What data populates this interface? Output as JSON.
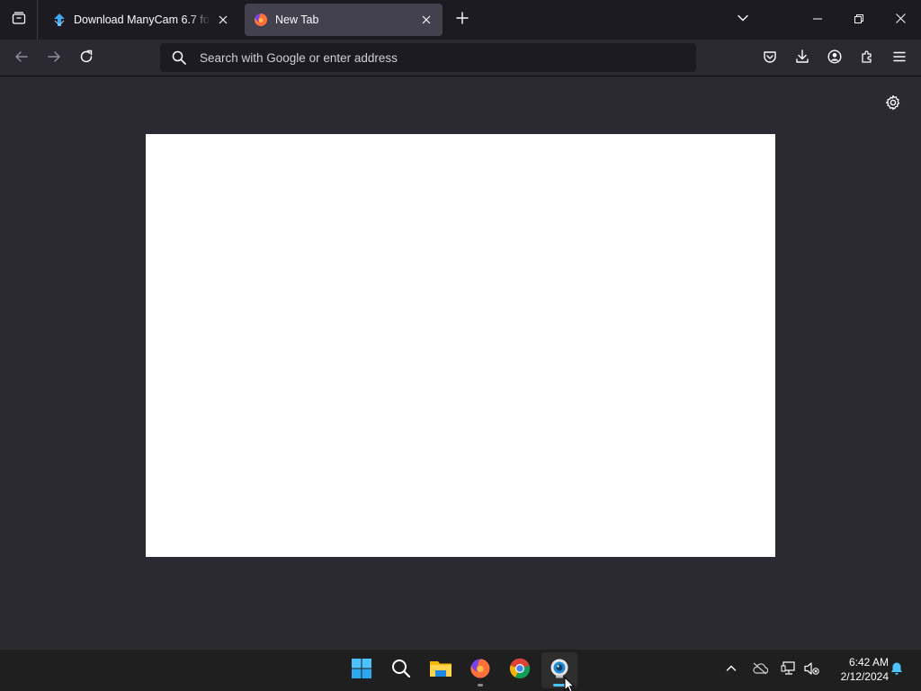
{
  "tabs": [
    {
      "title": "Download ManyCam 6.7 for Windows",
      "active": false,
      "favicon": "manycam-download-icon"
    },
    {
      "title": "New Tab",
      "active": true,
      "favicon": "firefox-icon"
    }
  ],
  "toolbar": {
    "search_placeholder": "Search with Google or enter address"
  },
  "icons": {
    "tab_list": "tab-list-icon",
    "new_tab": "plus-icon",
    "overflow": "chevron-down-icon",
    "back": "back-arrow-icon",
    "forward": "forward-arrow-icon",
    "reload": "reload-icon",
    "pocket": "pocket-icon",
    "downloads": "download-icon",
    "account": "account-icon",
    "extensions": "extensions-icon",
    "menu": "hamburger-menu-icon",
    "settings": "gear-icon"
  },
  "taskbar": {
    "apps": [
      {
        "name": "start",
        "icon": "windows-start-icon"
      },
      {
        "name": "search",
        "icon": "search-icon"
      },
      {
        "name": "file-explorer",
        "icon": "folder-icon"
      },
      {
        "name": "firefox",
        "icon": "firefox-icon"
      },
      {
        "name": "chrome",
        "icon": "chrome-icon"
      },
      {
        "name": "manycam",
        "icon": "manycam-icon"
      }
    ],
    "clock_time": "6:42 AM",
    "clock_date": "2/12/2024"
  },
  "colors": {
    "chrome_dark": "#1c1b22",
    "toolbar": "#2b2a33",
    "active_tab": "#42414d",
    "taskbar": "#1f1f1f"
  }
}
